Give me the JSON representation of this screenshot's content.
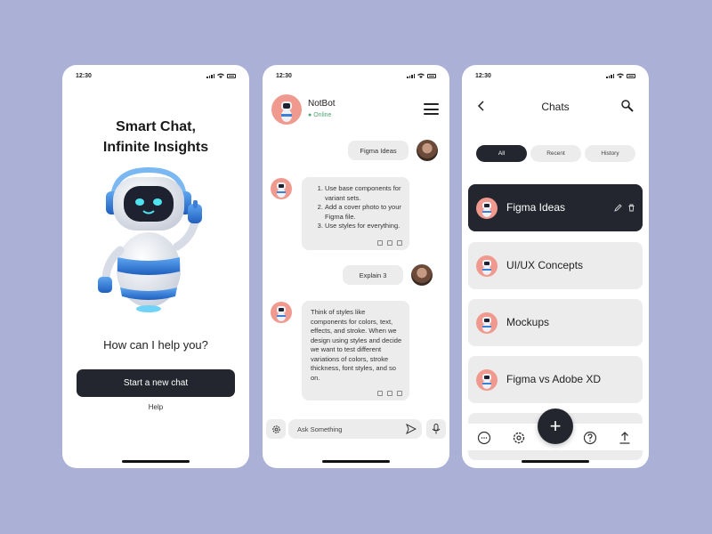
{
  "status": {
    "time": "12:30"
  },
  "welcome": {
    "title_line1": "Smart Chat,",
    "title_line2": "Infinite Insights",
    "question": "How can I help you?",
    "start_button": "Start a new chat",
    "help_link": "Help"
  },
  "chat": {
    "bot_name": "NotBot",
    "bot_status": "Online",
    "messages": [
      {
        "from": "user",
        "text": "Figma Ideas"
      },
      {
        "from": "bot",
        "items": [
          "Use base components for variant sets.",
          "Add a cover photo to your Figma file.",
          "Use styles for everything."
        ]
      },
      {
        "from": "user",
        "text": "Explain 3"
      },
      {
        "from": "bot",
        "text": "Think of styles like components for colors, text, effects, and stroke. When we design using styles and decide we want to test different variations of colors, stroke thickness, font styles, and so on."
      }
    ],
    "input_placeholder": "Ask Something",
    "icons": {
      "settings": "gear-icon",
      "send": "send-icon",
      "mic": "mic-icon",
      "menu": "menu-icon"
    }
  },
  "chats_screen": {
    "title": "Chats",
    "tabs": [
      {
        "label": "All",
        "active": true
      },
      {
        "label": "Recent",
        "active": false
      },
      {
        "label": "History",
        "active": false
      }
    ],
    "items": [
      {
        "label": "Figma Ideas",
        "active": true
      },
      {
        "label": "UI/UX Concepts",
        "active": false
      },
      {
        "label": "Mockups",
        "active": false
      },
      {
        "label": "Figma vs Adobe XD",
        "active": false
      }
    ],
    "fab_label": "+",
    "nav_icons": [
      "chat-icon",
      "gear-icon",
      "help-icon",
      "upload-icon"
    ]
  },
  "colors": {
    "background": "#aab0d6",
    "dark": "#23262e",
    "bubble": "#ececec",
    "avatar": "#f09a8f",
    "online": "#4fa672"
  }
}
